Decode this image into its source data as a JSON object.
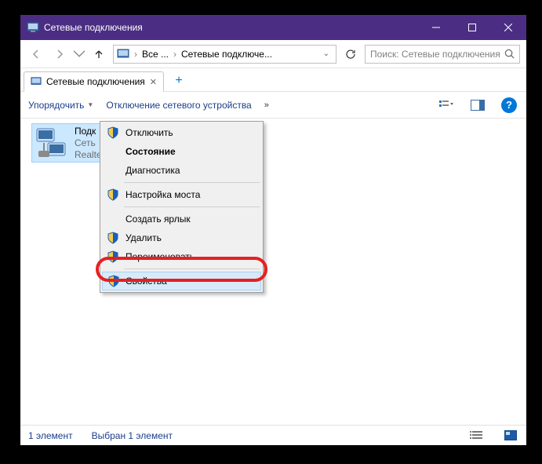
{
  "window": {
    "title": "Сетевые подключения"
  },
  "breadcrumb": {
    "item1": "Все ...",
    "item2": "Сетевые подключе..."
  },
  "search": {
    "placeholder": "Поиск: Сетевые подключения"
  },
  "tab": {
    "label": "Сетевые подключения"
  },
  "toolbar": {
    "organize": "Упорядочить",
    "disable": "Отключение сетевого устройства"
  },
  "connection": {
    "name": "Подк",
    "line2": "Сеть",
    "line3": "Realte"
  },
  "context_menu": {
    "items": [
      {
        "label": "Отключить",
        "shield": true,
        "bold": false
      },
      {
        "label": "Состояние",
        "shield": false,
        "bold": true
      },
      {
        "label": "Диагностика",
        "shield": false,
        "bold": false
      }
    ],
    "group2": [
      {
        "label": "Настройка моста",
        "shield": true
      }
    ],
    "group3": [
      {
        "label": "Создать ярлык",
        "shield": false
      },
      {
        "label": "Удалить",
        "shield": true
      },
      {
        "label": "Переименовать",
        "shield": true
      }
    ],
    "group4": [
      {
        "label": "Свойства",
        "shield": true
      }
    ]
  },
  "statusbar": {
    "count": "1 элемент",
    "selected": "Выбран 1 элемент"
  },
  "colors": {
    "titlebar": "#4b2e83",
    "highlight": "#e62020",
    "selection": "#cce8ff"
  }
}
